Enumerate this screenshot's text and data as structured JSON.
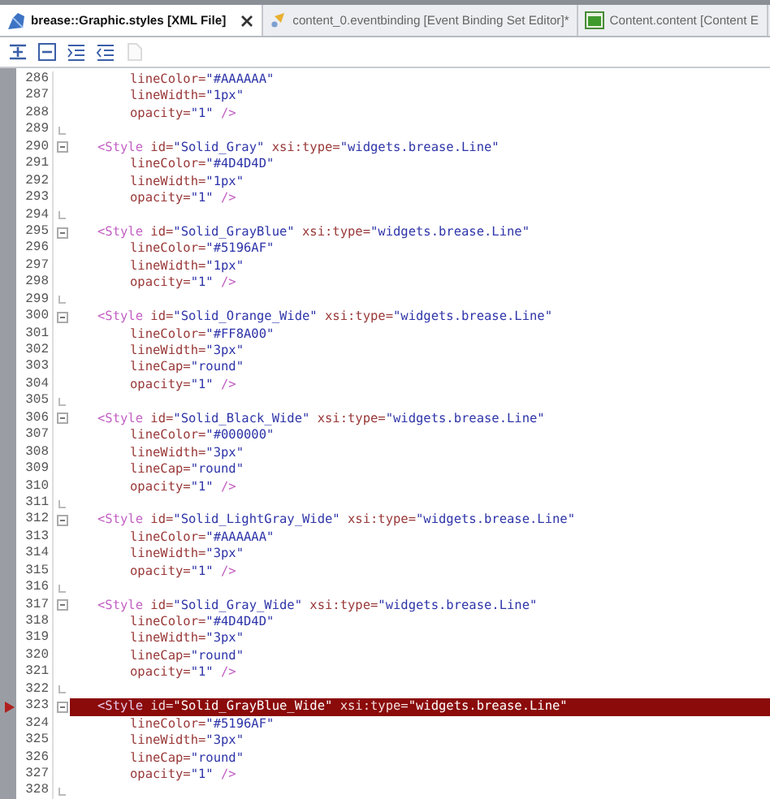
{
  "tabs": [
    {
      "label": "brease::Graphic.styles [XML File]",
      "selected": true,
      "kind": "xml"
    },
    {
      "label": "content_0.eventbinding [Event Binding Set Editor]*",
      "selected": false,
      "kind": "binding"
    },
    {
      "label": "Content.content [Content E",
      "selected": false,
      "kind": "content"
    }
  ],
  "toolbar": [
    {
      "kind": "expand",
      "disabled": false
    },
    {
      "kind": "collapse",
      "disabled": false
    },
    {
      "kind": "indent",
      "disabled": false
    },
    {
      "kind": "outdent",
      "disabled": false
    },
    {
      "kind": "page",
      "disabled": true
    }
  ],
  "editor": {
    "lines": [
      {
        "number": "286",
        "kind": "attribute",
        "current": false,
        "fold_end": false,
        "tokens": [
          {
            "kind": "attr",
            "text": "lineColor="
          },
          {
            "kind": "value",
            "text": "\"#AAAAAA\""
          }
        ]
      },
      {
        "number": "287",
        "kind": "attribute",
        "current": false,
        "fold_end": false,
        "tokens": [
          {
            "kind": "attr",
            "text": "lineWidth="
          },
          {
            "kind": "value",
            "text": "\"1px\""
          }
        ]
      },
      {
        "number": "288",
        "kind": "attribute",
        "current": false,
        "fold_end": false,
        "tokens": [
          {
            "kind": "attr",
            "text": "opacity="
          },
          {
            "kind": "value",
            "text": "\"1\""
          },
          {
            "kind": "tag",
            "text": " />"
          }
        ]
      },
      {
        "number": "289",
        "kind": "blank",
        "current": false,
        "fold_end": true
      },
      {
        "number": "290",
        "kind": "element",
        "current": false,
        "fold_end": false,
        "tokens": [
          {
            "kind": "tag",
            "text": "<Style"
          },
          {
            "kind": "attr",
            "text": " id="
          },
          {
            "kind": "value",
            "text": "\"Solid_Gray\""
          },
          {
            "kind": "attr",
            "text": " xsi:type="
          },
          {
            "kind": "value",
            "text": "\"widgets.brease.Line\""
          }
        ]
      },
      {
        "number": "291",
        "kind": "attribute",
        "current": false,
        "fold_end": false,
        "tokens": [
          {
            "kind": "attr",
            "text": "lineColor="
          },
          {
            "kind": "value",
            "text": "\"#4D4D4D\""
          }
        ]
      },
      {
        "number": "292",
        "kind": "attribute",
        "current": false,
        "fold_end": false,
        "tokens": [
          {
            "kind": "attr",
            "text": "lineWidth="
          },
          {
            "kind": "value",
            "text": "\"1px\""
          }
        ]
      },
      {
        "number": "293",
        "kind": "attribute",
        "current": false,
        "fold_end": false,
        "tokens": [
          {
            "kind": "attr",
            "text": "opacity="
          },
          {
            "kind": "value",
            "text": "\"1\""
          },
          {
            "kind": "tag",
            "text": " />"
          }
        ]
      },
      {
        "number": "294",
        "kind": "blank",
        "current": false,
        "fold_end": true
      },
      {
        "number": "295",
        "kind": "element",
        "current": false,
        "fold_end": false,
        "tokens": [
          {
            "kind": "tag",
            "text": "<Style"
          },
          {
            "kind": "attr",
            "text": " id="
          },
          {
            "kind": "value",
            "text": "\"Solid_GrayBlue\""
          },
          {
            "kind": "attr",
            "text": " xsi:type="
          },
          {
            "kind": "value",
            "text": "\"widgets.brease.Line\""
          }
        ]
      },
      {
        "number": "296",
        "kind": "attribute",
        "current": false,
        "fold_end": false,
        "tokens": [
          {
            "kind": "attr",
            "text": "lineColor="
          },
          {
            "kind": "value",
            "text": "\"#5196AF\""
          }
        ]
      },
      {
        "number": "297",
        "kind": "attribute",
        "current": false,
        "fold_end": false,
        "tokens": [
          {
            "kind": "attr",
            "text": "lineWidth="
          },
          {
            "kind": "value",
            "text": "\"1px\""
          }
        ]
      },
      {
        "number": "298",
        "kind": "attribute",
        "current": false,
        "fold_end": false,
        "tokens": [
          {
            "kind": "attr",
            "text": "opacity="
          },
          {
            "kind": "value",
            "text": "\"1\""
          },
          {
            "kind": "tag",
            "text": " />"
          }
        ]
      },
      {
        "number": "299",
        "kind": "blank",
        "current": false,
        "fold_end": true
      },
      {
        "number": "300",
        "kind": "element",
        "current": false,
        "fold_end": false,
        "tokens": [
          {
            "kind": "tag",
            "text": "<Style"
          },
          {
            "kind": "attr",
            "text": " id="
          },
          {
            "kind": "value",
            "text": "\"Solid_Orange_Wide\""
          },
          {
            "kind": "attr",
            "text": " xsi:type="
          },
          {
            "kind": "value",
            "text": "\"widgets.brease.Line\""
          }
        ]
      },
      {
        "number": "301",
        "kind": "attribute",
        "current": false,
        "fold_end": false,
        "tokens": [
          {
            "kind": "attr",
            "text": "lineColor="
          },
          {
            "kind": "value",
            "text": "\"#FF8A00\""
          }
        ]
      },
      {
        "number": "302",
        "kind": "attribute",
        "current": false,
        "fold_end": false,
        "tokens": [
          {
            "kind": "attr",
            "text": "lineWidth="
          },
          {
            "kind": "value",
            "text": "\"3px\""
          }
        ]
      },
      {
        "number": "303",
        "kind": "attribute",
        "current": false,
        "fold_end": false,
        "tokens": [
          {
            "kind": "attr",
            "text": "lineCap="
          },
          {
            "kind": "value",
            "text": "\"round\""
          }
        ]
      },
      {
        "number": "304",
        "kind": "attribute",
        "current": false,
        "fold_end": false,
        "tokens": [
          {
            "kind": "attr",
            "text": "opacity="
          },
          {
            "kind": "value",
            "text": "\"1\""
          },
          {
            "kind": "tag",
            "text": " />"
          }
        ]
      },
      {
        "number": "305",
        "kind": "blank",
        "current": false,
        "fold_end": true
      },
      {
        "number": "306",
        "kind": "element",
        "current": false,
        "fold_end": false,
        "tokens": [
          {
            "kind": "tag",
            "text": "<Style"
          },
          {
            "kind": "attr",
            "text": " id="
          },
          {
            "kind": "value",
            "text": "\"Solid_Black_Wide\""
          },
          {
            "kind": "attr",
            "text": " xsi:type="
          },
          {
            "kind": "value",
            "text": "\"widgets.brease.Line\""
          }
        ]
      },
      {
        "number": "307",
        "kind": "attribute",
        "current": false,
        "fold_end": false,
        "tokens": [
          {
            "kind": "attr",
            "text": "lineColor="
          },
          {
            "kind": "value",
            "text": "\"#000000\""
          }
        ]
      },
      {
        "number": "308",
        "kind": "attribute",
        "current": false,
        "fold_end": false,
        "tokens": [
          {
            "kind": "attr",
            "text": "lineWidth="
          },
          {
            "kind": "value",
            "text": "\"3px\""
          }
        ]
      },
      {
        "number": "309",
        "kind": "attribute",
        "current": false,
        "fold_end": false,
        "tokens": [
          {
            "kind": "attr",
            "text": "lineCap="
          },
          {
            "kind": "value",
            "text": "\"round\""
          }
        ]
      },
      {
        "number": "310",
        "kind": "attribute",
        "current": false,
        "fold_end": false,
        "tokens": [
          {
            "kind": "attr",
            "text": "opacity="
          },
          {
            "kind": "value",
            "text": "\"1\""
          },
          {
            "kind": "tag",
            "text": " />"
          }
        ]
      },
      {
        "number": "311",
        "kind": "blank",
        "current": false,
        "fold_end": true
      },
      {
        "number": "312",
        "kind": "element",
        "current": false,
        "fold_end": false,
        "tokens": [
          {
            "kind": "tag",
            "text": "<Style"
          },
          {
            "kind": "attr",
            "text": " id="
          },
          {
            "kind": "value",
            "text": "\"Solid_LightGray_Wide\""
          },
          {
            "kind": "attr",
            "text": " xsi:type="
          },
          {
            "kind": "value",
            "text": "\"widgets.brease.Line\""
          }
        ]
      },
      {
        "number": "313",
        "kind": "attribute",
        "current": false,
        "fold_end": false,
        "tokens": [
          {
            "kind": "attr",
            "text": "lineColor="
          },
          {
            "kind": "value",
            "text": "\"#AAAAAA\""
          }
        ]
      },
      {
        "number": "314",
        "kind": "attribute",
        "current": false,
        "fold_end": false,
        "tokens": [
          {
            "kind": "attr",
            "text": "lineWidth="
          },
          {
            "kind": "value",
            "text": "\"3px\""
          }
        ]
      },
      {
        "number": "315",
        "kind": "attribute",
        "current": false,
        "fold_end": false,
        "tokens": [
          {
            "kind": "attr",
            "text": "opacity="
          },
          {
            "kind": "value",
            "text": "\"1\""
          },
          {
            "kind": "tag",
            "text": " />"
          }
        ]
      },
      {
        "number": "316",
        "kind": "blank",
        "current": false,
        "fold_end": true
      },
      {
        "number": "317",
        "kind": "element",
        "current": false,
        "fold_end": false,
        "tokens": [
          {
            "kind": "tag",
            "text": "<Style"
          },
          {
            "kind": "attr",
            "text": " id="
          },
          {
            "kind": "value",
            "text": "\"Solid_Gray_Wide\""
          },
          {
            "kind": "attr",
            "text": " xsi:type="
          },
          {
            "kind": "value",
            "text": "\"widgets.brease.Line\""
          }
        ]
      },
      {
        "number": "318",
        "kind": "attribute",
        "current": false,
        "fold_end": false,
        "tokens": [
          {
            "kind": "attr",
            "text": "lineColor="
          },
          {
            "kind": "value",
            "text": "\"#4D4D4D\""
          }
        ]
      },
      {
        "number": "319",
        "kind": "attribute",
        "current": false,
        "fold_end": false,
        "tokens": [
          {
            "kind": "attr",
            "text": "lineWidth="
          },
          {
            "kind": "value",
            "text": "\"3px\""
          }
        ]
      },
      {
        "number": "320",
        "kind": "attribute",
        "current": false,
        "fold_end": false,
        "tokens": [
          {
            "kind": "attr",
            "text": "lineCap="
          },
          {
            "kind": "value",
            "text": "\"round\""
          }
        ]
      },
      {
        "number": "321",
        "kind": "attribute",
        "current": false,
        "fold_end": false,
        "tokens": [
          {
            "kind": "attr",
            "text": "opacity="
          },
          {
            "kind": "value",
            "text": "\"1\""
          },
          {
            "kind": "tag",
            "text": " />"
          }
        ]
      },
      {
        "number": "322",
        "kind": "blank",
        "current": false,
        "fold_end": true
      },
      {
        "number": "323",
        "kind": "element",
        "current": true,
        "fold_end": false,
        "tokens": [
          {
            "kind": "tag",
            "text": "<Style"
          },
          {
            "kind": "attr",
            "text": " id="
          },
          {
            "kind": "value",
            "text": "\"Solid_GrayBlue_Wide\""
          },
          {
            "kind": "attr",
            "text": " xsi:type="
          },
          {
            "kind": "value",
            "text": "\"widgets.brease.Line\""
          }
        ]
      },
      {
        "number": "324",
        "kind": "attribute",
        "current": false,
        "fold_end": false,
        "tokens": [
          {
            "kind": "attr",
            "text": "lineColor="
          },
          {
            "kind": "value",
            "text": "\"#5196AF\""
          }
        ]
      },
      {
        "number": "325",
        "kind": "attribute",
        "current": false,
        "fold_end": false,
        "tokens": [
          {
            "kind": "attr",
            "text": "lineWidth="
          },
          {
            "kind": "value",
            "text": "\"3px\""
          }
        ]
      },
      {
        "number": "326",
        "kind": "attribute",
        "current": false,
        "fold_end": false,
        "tokens": [
          {
            "kind": "attr",
            "text": "lineCap="
          },
          {
            "kind": "value",
            "text": "\"round\""
          }
        ]
      },
      {
        "number": "327",
        "kind": "attribute",
        "current": false,
        "fold_end": false,
        "tokens": [
          {
            "kind": "attr",
            "text": "opacity="
          },
          {
            "kind": "value",
            "text": "\"1\""
          },
          {
            "kind": "tag",
            "text": " />"
          }
        ]
      },
      {
        "number": "328",
        "kind": "blank",
        "current": false,
        "fold_end": true
      }
    ]
  }
}
